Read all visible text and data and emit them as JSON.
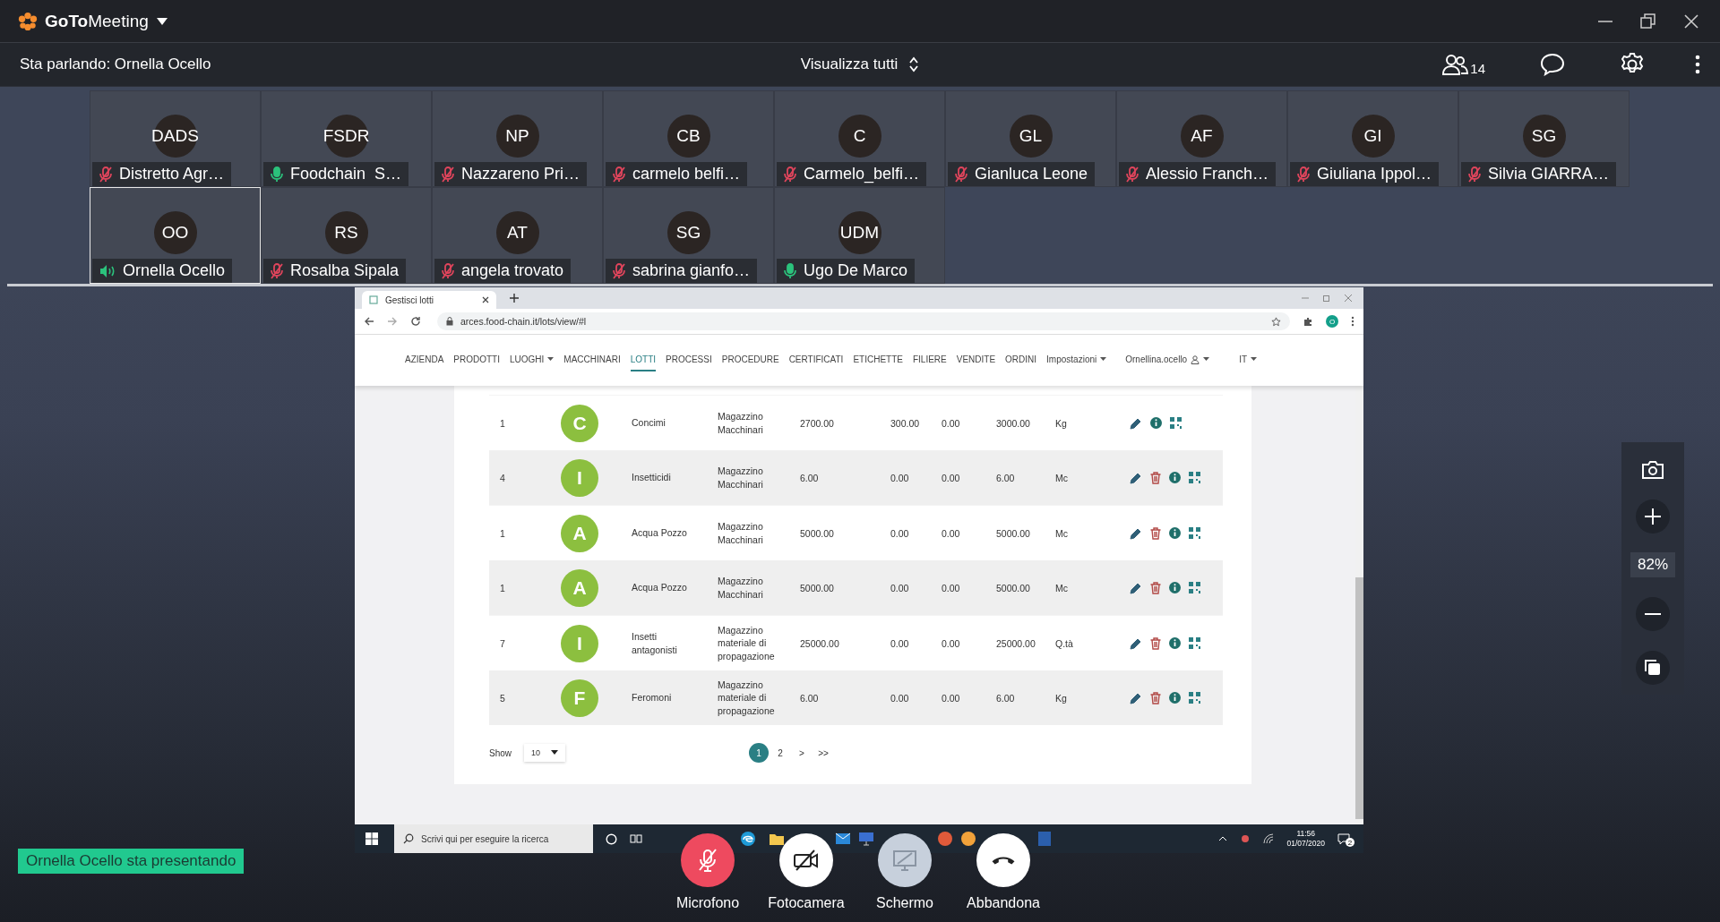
{
  "app": {
    "logo": "**GoTo**Meeting"
  },
  "header": {
    "speaking": "Sta parlando: Ornella Ocello",
    "view": "Visualizza tutti",
    "participants_count": "14"
  },
  "participants": [
    {
      "initials": "DADS",
      "name": "Distretto Agr…",
      "muted": true,
      "speaking": false,
      "selected": false
    },
    {
      "initials": "FSDR",
      "name": "Foodchain  S…",
      "muted": false,
      "speaking": false,
      "selected": false
    },
    {
      "initials": "NP",
      "name": "Nazzareno Pri…",
      "muted": true,
      "speaking": false,
      "selected": false
    },
    {
      "initials": "CB",
      "name": "carmelo belfi…",
      "muted": true,
      "speaking": false,
      "selected": false
    },
    {
      "initials": "C",
      "name": "Carmelo_belfi…",
      "muted": true,
      "speaking": false,
      "selected": false
    },
    {
      "initials": "GL",
      "name": "Gianluca Leone",
      "muted": true,
      "speaking": false,
      "selected": false
    },
    {
      "initials": "AF",
      "name": "Alessio Franch…",
      "muted": true,
      "speaking": false,
      "selected": false
    },
    {
      "initials": "GI",
      "name": "Giuliana Ippol…",
      "muted": true,
      "speaking": false,
      "selected": false
    },
    {
      "initials": "SG",
      "name": "Silvia GIARRA…",
      "muted": true,
      "speaking": false,
      "selected": false
    },
    {
      "initials": "OO",
      "name": "Ornella Ocello",
      "muted": false,
      "speaking": true,
      "selected": true
    },
    {
      "initials": "RS",
      "name": "Rosalba Sipala",
      "muted": true,
      "speaking": false,
      "selected": false
    },
    {
      "initials": "AT",
      "name": "angela trovato",
      "muted": true,
      "speaking": false,
      "selected": false
    },
    {
      "initials": "SG",
      "name": "sabrina gianfo…",
      "muted": true,
      "speaking": false,
      "selected": false
    },
    {
      "initials": "UDM",
      "name": "Ugo De Marco",
      "muted": false,
      "speaking": false,
      "selected": false
    }
  ],
  "shared_screen": {
    "browser": {
      "tab": "Gestisci lotti",
      "url": "arces.food-chain.it/lots/view/#l",
      "profile": "O"
    },
    "nav": [
      {
        "label": "AZIENDA",
        "kind": "link",
        "dropdown": false,
        "selected": false
      },
      {
        "label": "PRODOTTI",
        "kind": "link",
        "dropdown": false,
        "selected": false
      },
      {
        "label": "LUOGHI",
        "kind": "link",
        "dropdown": true,
        "selected": false
      },
      {
        "label": "MACCHINARI",
        "kind": "link",
        "dropdown": false,
        "selected": false
      },
      {
        "label": "LOTTI",
        "kind": "link",
        "dropdown": false,
        "selected": true
      },
      {
        "label": "PROCESSI",
        "kind": "link",
        "dropdown": false,
        "selected": false
      },
      {
        "label": "PROCEDURE",
        "kind": "link",
        "dropdown": false,
        "selected": false
      },
      {
        "label": "CERTIFICATI",
        "kind": "link",
        "dropdown": false,
        "selected": false
      },
      {
        "label": "ETICHETTE",
        "kind": "link",
        "dropdown": false,
        "selected": false
      },
      {
        "label": "FILIERE",
        "kind": "link",
        "dropdown": false,
        "selected": false
      },
      {
        "label": "VENDITE",
        "kind": "link",
        "dropdown": false,
        "selected": false
      },
      {
        "label": "ORDINI",
        "kind": "link",
        "dropdown": false,
        "selected": false
      },
      {
        "label": "Impostazioni",
        "kind": "link",
        "dropdown": true,
        "selected": false
      },
      {
        "label": "Ornellina.ocello",
        "kind": "user",
        "dropdown": true,
        "selected": false
      },
      {
        "label": "IT",
        "kind": "link",
        "dropdown": true,
        "selected": false
      }
    ],
    "rows": [
      {
        "initial": "C",
        "cells": [
          "1",
          "Concimi",
          "Magazzino Macchinari",
          "2700.00",
          "300.00",
          "0.00",
          "3000.00",
          "Kg"
        ],
        "deletable": false
      },
      {
        "initial": "I",
        "cells": [
          "4",
          "Insetticidi",
          "Magazzino Macchinari",
          "6.00",
          "0.00",
          "0.00",
          "6.00",
          "Mc"
        ],
        "deletable": true
      },
      {
        "initial": "A",
        "cells": [
          "1",
          "Acqua Pozzo",
          "Magazzino Macchinari",
          "5000.00",
          "0.00",
          "0.00",
          "5000.00",
          "Mc"
        ],
        "deletable": true
      },
      {
        "initial": "A",
        "cells": [
          "1",
          "Acqua Pozzo",
          "Magazzino Macchinari",
          "5000.00",
          "0.00",
          "0.00",
          "5000.00",
          "Mc"
        ],
        "deletable": true
      },
      {
        "initial": "I",
        "cells": [
          "7",
          "Insetti antagonisti",
          "Magazzino materiale di propagazione",
          "25000.00",
          "0.00",
          "0.00",
          "25000.00",
          "Q.tà"
        ],
        "deletable": true
      },
      {
        "initial": "F",
        "cells": [
          "5",
          "Feromoni",
          "Magazzino materiale di propagazione",
          "6.00",
          "0.00",
          "0.00",
          "6.00",
          "Kg"
        ],
        "deletable": true
      }
    ],
    "pagination": {
      "show_label": "Show",
      "page_size": "10",
      "pages": [
        {
          "label": "1",
          "selected": true
        },
        {
          "label": "2",
          "selected": false
        }
      ],
      "next": ">",
      "last": ">>"
    },
    "taskbar": {
      "search_placeholder": "Scrivi qui per eseguire la ricerca",
      "time": "11:56",
      "date": "01/07/2020",
      "notifications": "2"
    }
  },
  "zoom": {
    "level_text": "82%"
  },
  "presenter_badge": "Ornella Ocello sta presentando",
  "controls": [
    {
      "label": "Microfono",
      "kind": "mic",
      "muted": true
    },
    {
      "label": "Fotocamera",
      "kind": "camera",
      "muted": true
    },
    {
      "label": "Schermo",
      "kind": "screen",
      "disabled": true
    },
    {
      "label": "Abbandona",
      "kind": "leave"
    }
  ]
}
